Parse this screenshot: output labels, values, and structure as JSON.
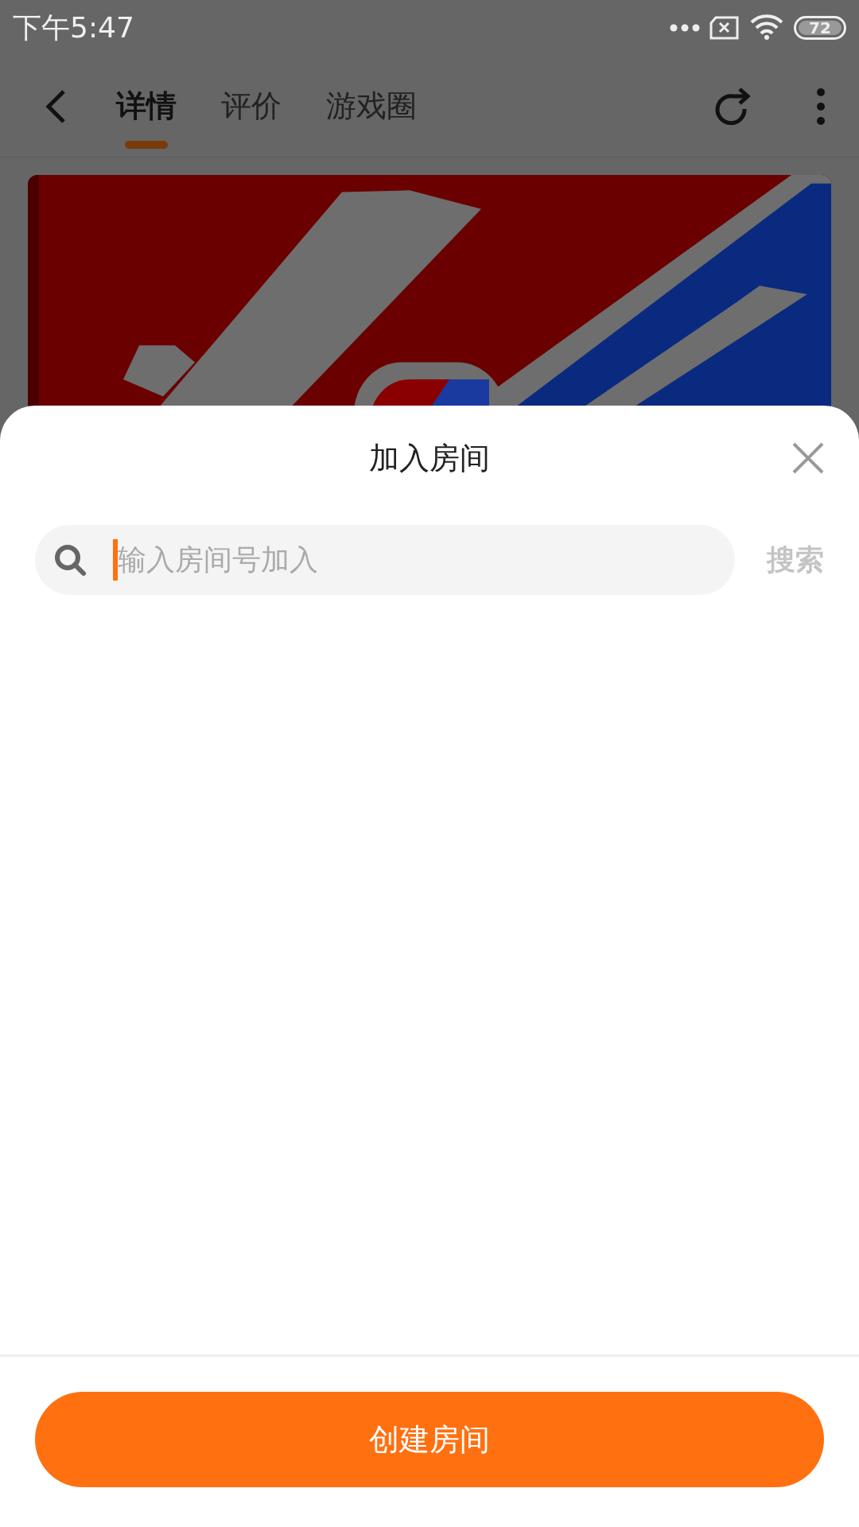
{
  "status_bar": {
    "time": "下午5:47",
    "battery": "72"
  },
  "tabs": [
    {
      "label": "详情",
      "selected": true
    },
    {
      "label": "评价",
      "selected": false
    },
    {
      "label": "游戏圈",
      "selected": false
    }
  ],
  "dialog": {
    "title": "加入房间",
    "search": {
      "placeholder": "输入房间号加入",
      "focused": true
    },
    "search_button": "搜索",
    "create_button": "创建房间"
  }
}
